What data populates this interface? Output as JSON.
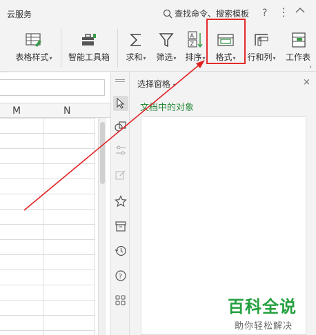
{
  "topbar": {
    "cloud_label": "云服务",
    "search_text": "查找命令、搜索模板",
    "help_label": "?",
    "more_label": "⋮"
  },
  "ribbon": {
    "buttons": [
      {
        "label": "表格样式",
        "has_arrow": true
      },
      {
        "label": "智能工具箱",
        "has_arrow": false
      },
      {
        "label": "求和",
        "has_arrow": true
      },
      {
        "label": "筛选",
        "has_arrow": true
      },
      {
        "label": "排序",
        "has_arrow": true
      },
      {
        "label": "格式",
        "has_arrow": true
      },
      {
        "label": "行和列",
        "has_arrow": true
      },
      {
        "label": "工作表",
        "has_arrow": false
      }
    ],
    "dropdown_arrow": "▾"
  },
  "sheet": {
    "columns": [
      "M",
      "N"
    ]
  },
  "selection_pane": {
    "title": "选择窗格",
    "close_label": "×",
    "subtitle": "文档中的对象"
  },
  "watermark": {
    "brand": "百科全说",
    "tagline": "助你轻松解决"
  },
  "colors": {
    "highlight_red": "#e32b2b",
    "subtitle_green": "#2a8a3a",
    "watermark_green": "#23a03e"
  }
}
